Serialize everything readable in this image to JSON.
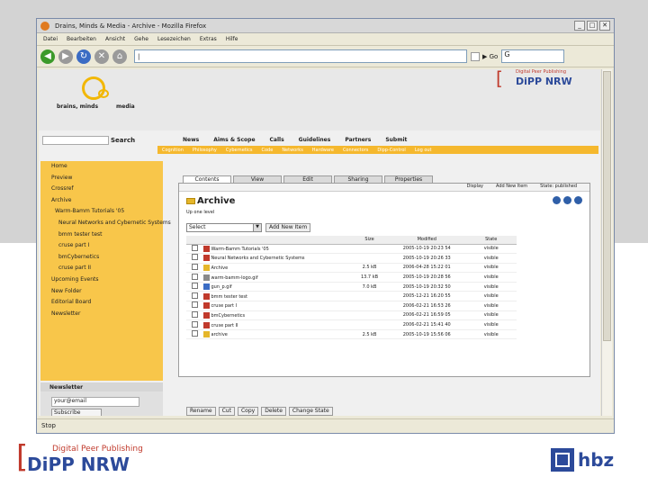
{
  "window": {
    "title": "Drains, Minds & Media - Archive - Mozilla Firefox"
  },
  "browser_menu": [
    "Datei",
    "Bearbeiten",
    "Ansicht",
    "Gehe",
    "Lesezeichen",
    "Extras",
    "Hilfe"
  ],
  "url_bar": {
    "value": "|"
  },
  "header": {
    "logo_text_left": "brains, minds",
    "logo_text_right": "media",
    "dipp_small_sub": "Digital Peer Publishing",
    "dipp_small_main": "DiPP NRW"
  },
  "site_search": {
    "button_label": "Search"
  },
  "top_nav": [
    "News",
    "Aims & Scope",
    "Calls",
    "Guidelines",
    "Partners",
    "Submit"
  ],
  "sub_nav": [
    "Cognition",
    "Philosophy",
    "Cybernetics",
    "Code",
    "Networks",
    "Hardware",
    "Connectors",
    "Dipp-Control",
    "Log out"
  ],
  "sidebar": {
    "items": [
      {
        "label": "Home",
        "level": 0
      },
      {
        "label": "Preview",
        "level": 0
      },
      {
        "label": "Crossref",
        "level": 0
      },
      {
        "label": "Archive",
        "level": 0
      },
      {
        "label": "Warm-Bamm Tutorials '05",
        "level": 1
      },
      {
        "label": "Neural Networks and Cybernetic Systems",
        "level": 2
      },
      {
        "label": "bmm tester test",
        "level": 2
      },
      {
        "label": "cruse part I",
        "level": 2
      },
      {
        "label": "bmCybernetics",
        "level": 2
      },
      {
        "label": "cruse part II",
        "level": 2
      },
      {
        "label": "Upcoming Events",
        "level": 0
      },
      {
        "label": "New Folder",
        "level": 0
      },
      {
        "label": "Editorial Board",
        "level": 0
      },
      {
        "label": "Newsletter",
        "level": 0
      }
    ]
  },
  "newsletter": {
    "title": "Newsletter",
    "input_value": "your@email",
    "button_label": "Subscribe"
  },
  "tabs": [
    "Contents",
    "View",
    "Edit",
    "Sharing",
    "Properties"
  ],
  "panel_actions": [
    "Display",
    "Add New Item",
    "State: published"
  ],
  "archive": {
    "title": "Archive",
    "up_link": "Up one level",
    "select_value": "Select",
    "add_button": "Add New Item",
    "columns": [
      "",
      "",
      "Size",
      "Modified",
      "State"
    ],
    "rows": [
      {
        "type": "doc",
        "title": "Warm-Bamm Tutorials '05",
        "size": "",
        "modified": "2005-10-19 20:23 54",
        "state": "visible"
      },
      {
        "type": "doc",
        "title": "Neural Networks and Cybernetic Systems",
        "size": "",
        "modified": "2005-10-19 20:26 33",
        "state": "visible"
      },
      {
        "type": "folder",
        "title": "Archive",
        "size": "2.5 kB",
        "modified": "2006-04-28 15:22 01",
        "state": "visible"
      },
      {
        "type": "img",
        "title": "warm-bamm-logo.gif",
        "size": "13.7 kB",
        "modified": "2005-10-19 20:28 56",
        "state": "visible"
      },
      {
        "type": "file",
        "title": "gun_p.gif",
        "size": "7.0 kB",
        "modified": "2005-10-19 20:32 50",
        "state": "visible"
      },
      {
        "type": "doc",
        "title": "bmm tester test",
        "size": "",
        "modified": "2005-12-21 16:20 55",
        "state": "visible"
      },
      {
        "type": "doc",
        "title": "cruse part I",
        "size": "",
        "modified": "2006-02-21 16:53 26",
        "state": "visible"
      },
      {
        "type": "doc",
        "title": "bmCybernetics",
        "size": "",
        "modified": "2006-02-21 16:59 05",
        "state": "visible"
      },
      {
        "type": "doc",
        "title": "cruse part II",
        "size": "",
        "modified": "2006-02-21 15:41 40",
        "state": "visible"
      },
      {
        "type": "folder",
        "title": "archive",
        "size": "2.5 kB",
        "modified": "2005-10-19 15:56 06",
        "state": "visible"
      }
    ],
    "bottom_actions": [
      "Rename",
      "Cut",
      "Copy",
      "Delete",
      "Change State"
    ]
  },
  "statusbar": {
    "text": "Stop"
  },
  "footer": {
    "dipp_sub": "Digital Peer Publishing",
    "dipp_main": "DiPP NRW",
    "hbz": "hbz"
  }
}
